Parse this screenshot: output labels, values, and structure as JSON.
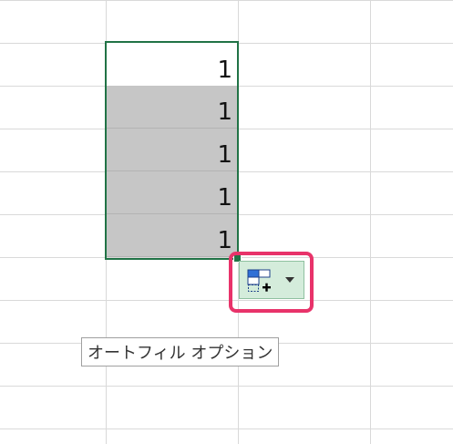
{
  "sheet": {
    "cells": [
      {
        "value": "1",
        "state": "active"
      },
      {
        "value": "1",
        "state": "selected"
      },
      {
        "value": "1",
        "state": "selected"
      },
      {
        "value": "1",
        "state": "selected"
      },
      {
        "value": "1",
        "state": "selected"
      }
    ]
  },
  "autofill": {
    "icon": "autofill-options-icon",
    "dropdown_icon": "dropdown-arrow-icon",
    "accent_color": "#217346",
    "button_color": "#d4ecdb",
    "highlight_color": "#e8336a"
  },
  "tooltip": {
    "text": "オートフィル オプション"
  }
}
